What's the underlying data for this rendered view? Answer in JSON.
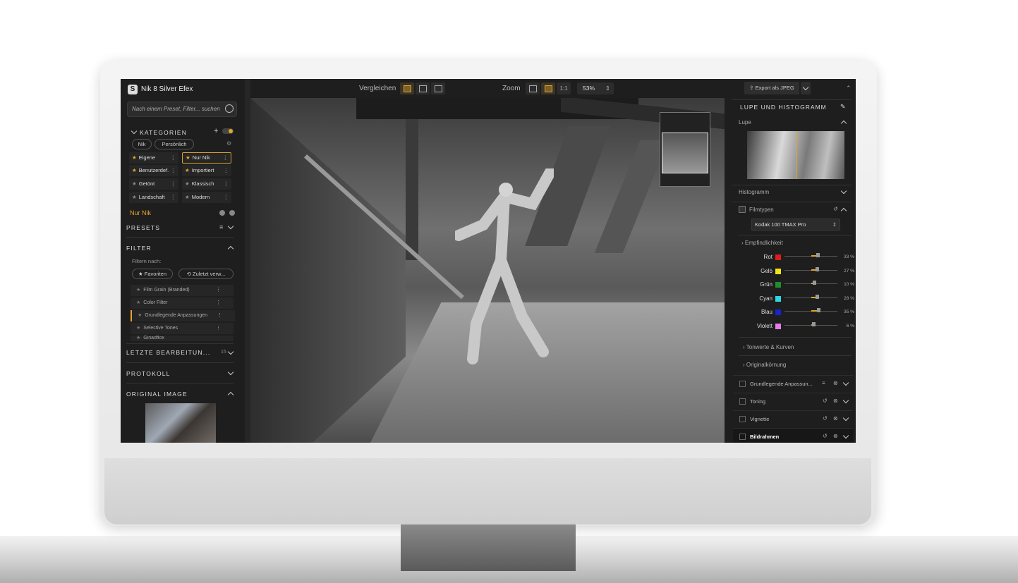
{
  "app": {
    "title": "Nik 8 Silver Efex",
    "logo": "S"
  },
  "search": {
    "placeholder": "Nach einem Preset, Filter... suchen"
  },
  "kategorien": {
    "header": "KATEGORIEN",
    "tabs": [
      "Nik",
      "Persönlich"
    ],
    "items": [
      {
        "label": "Eigene",
        "starred": true
      },
      {
        "label": "Nur Nik",
        "starred": true,
        "selected": true
      },
      {
        "label": "Benutzerdef.",
        "starred": true
      },
      {
        "label": "Importiert",
        "starred": true
      },
      {
        "label": "Getönt",
        "starred": false
      },
      {
        "label": "Klassisch",
        "starred": false
      },
      {
        "label": "Landschaft",
        "starred": false
      },
      {
        "label": "Modern",
        "starred": false
      }
    ],
    "current": "Nur Nik"
  },
  "presets": {
    "header": "PRESETS"
  },
  "filter": {
    "header": "FILTER",
    "filter_by": "Filtern nach:",
    "chips": [
      "Favoriten",
      "Zuletzt verw..."
    ],
    "items": [
      "Film Grain (Branded)",
      "Color Filter",
      "Grundlegende Anpassungen",
      "Selective Tones",
      "Ginadflox"
    ]
  },
  "recent": {
    "header": "LETZTE BEARBEITUN...",
    "count": "15"
  },
  "protokoll": {
    "header": "PROTOKOLL"
  },
  "original": {
    "header": "ORIGINAL IMAGE"
  },
  "toolbar": {
    "compare_label": "Vergleichen",
    "zoom_label": "Zoom",
    "zoom_1to1": "1:1",
    "zoom_value": "53%"
  },
  "right": {
    "export_label": "Export als JPEG",
    "loupe_header": "LUPE UND HISTOGRAMM",
    "loupe_label": "Lupe",
    "histogram_label": "Histogramm",
    "film_label": "Filmtypen",
    "film_value": "Kodak 100 TMAX Pro",
    "sensitivity_label": "Empfindlichkeit",
    "sliders": [
      {
        "label": "Rot",
        "color": "#e01b1b",
        "value": 33,
        "display": "33 %"
      },
      {
        "label": "Gelb",
        "color": "#f2e21a",
        "value": 27,
        "display": "27 %"
      },
      {
        "label": "Grün",
        "color": "#1f8f2a",
        "value": 10,
        "display": "10 %"
      },
      {
        "label": "Cyan",
        "color": "#2fd6e0",
        "value": 28,
        "display": "28 %"
      },
      {
        "label": "Blau",
        "color": "#1a22d6",
        "value": 35,
        "display": "35 %"
      },
      {
        "label": "Violett",
        "color": "#e57de8",
        "value": 6,
        "display": "6 %"
      }
    ],
    "tonwerte_label": "Tonwerte & Kurven",
    "koernung_label": "Originalkörnung",
    "panels": [
      "Grundlegende Anpassun...",
      "Toning",
      "Vignette",
      "Bildrahmen"
    ]
  }
}
